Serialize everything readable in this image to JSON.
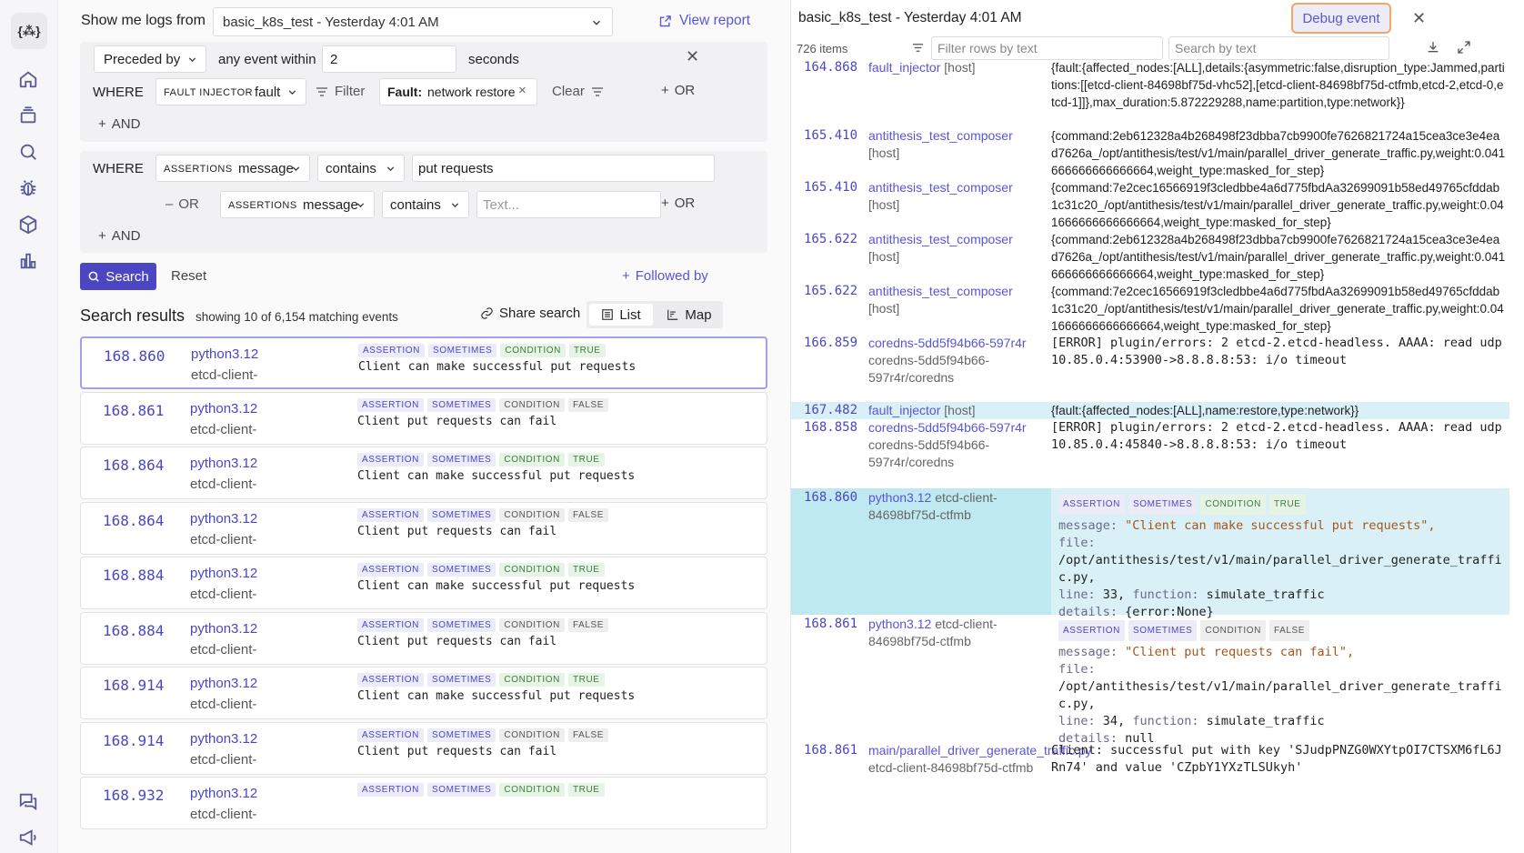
{
  "rail": {
    "logo": "{⁂}",
    "icons": [
      "home-icon",
      "layers-icon",
      "search-icon",
      "bug-icon",
      "cube-icon",
      "chart-icon",
      "chat-icon",
      "megaphone-icon"
    ]
  },
  "header": {
    "show_logs_label": "Show me logs from",
    "run_selected": "basic_k8s_test - Yesterday 4:01 AM",
    "view_report": "View report"
  },
  "preceded": {
    "mode": "Preceded by",
    "any_event_within": "any event within",
    "value": "2",
    "unit": "seconds",
    "where": "WHERE",
    "source_prefix": "FAULT INJECTOR",
    "source_field": "fault",
    "filter_label": "Filter",
    "chip_key": "Fault:",
    "chip_value": "network restore",
    "clear_label": "Clear",
    "or_label": "OR",
    "and_label": "AND"
  },
  "condition": {
    "where": "WHERE",
    "field_prefix": "ASSERTIONS",
    "field": "message",
    "op": "contains",
    "value": "put requests",
    "or_dash": "OR",
    "field2_prefix": "ASSERTIONS",
    "field2": "message",
    "op2": "contains",
    "placeholder2": "Text...",
    "or_label": "OR",
    "and_label": "AND"
  },
  "actions": {
    "search": "Search",
    "reset": "Reset",
    "followed_by": "Followed by"
  },
  "results": {
    "title": "Search results",
    "summary": "showing 10 of 6,154 matching events",
    "share": "Share search",
    "list": "List",
    "map": "Map",
    "items": [
      {
        "time": "168.860",
        "proc": "python3.12",
        "pod": "etcd-client-",
        "a": "ASSERTION",
        "s": "SOMETIMES",
        "c": "CONDITION",
        "v": "TRUE",
        "msg": "Client can make successful put requests"
      },
      {
        "time": "168.861",
        "proc": "python3.12",
        "pod": "etcd-client-",
        "a": "ASSERTION",
        "s": "SOMETIMES",
        "c": "CONDITION",
        "v": "FALSE",
        "msg": "Client put requests can fail"
      },
      {
        "time": "168.864",
        "proc": "python3.12",
        "pod": "etcd-client-",
        "a": "ASSERTION",
        "s": "SOMETIMES",
        "c": "CONDITION",
        "v": "TRUE",
        "msg": "Client can make successful put requests"
      },
      {
        "time": "168.864",
        "proc": "python3.12",
        "pod": "etcd-client-",
        "a": "ASSERTION",
        "s": "SOMETIMES",
        "c": "CONDITION",
        "v": "FALSE",
        "msg": "Client put requests can fail"
      },
      {
        "time": "168.884",
        "proc": "python3.12",
        "pod": "etcd-client-",
        "a": "ASSERTION",
        "s": "SOMETIMES",
        "c": "CONDITION",
        "v": "TRUE",
        "msg": "Client can make successful put requests"
      },
      {
        "time": "168.884",
        "proc": "python3.12",
        "pod": "etcd-client-",
        "a": "ASSERTION",
        "s": "SOMETIMES",
        "c": "CONDITION",
        "v": "FALSE",
        "msg": "Client put requests can fail"
      },
      {
        "time": "168.914",
        "proc": "python3.12",
        "pod": "etcd-client-",
        "a": "ASSERTION",
        "s": "SOMETIMES",
        "c": "CONDITION",
        "v": "TRUE",
        "msg": "Client can make successful put requests"
      },
      {
        "time": "168.914",
        "proc": "python3.12",
        "pod": "etcd-client-",
        "a": "ASSERTION",
        "s": "SOMETIMES",
        "c": "CONDITION",
        "v": "FALSE",
        "msg": "Client put requests can fail"
      },
      {
        "time": "168.932",
        "proc": "python3.12",
        "pod": "etcd-client-",
        "a": "ASSERTION",
        "s": "SOMETIMES",
        "c": "CONDITION",
        "v": "TRUE",
        "msg": ""
      }
    ]
  },
  "log": {
    "title": "basic_k8s_test - Yesterday 4:01 AM",
    "debug_event": "Debug event",
    "count": "726 items",
    "filter_placeholder": "Filter rows by text",
    "search_placeholder": "Search by text",
    "rows": [
      {
        "t": "164.868",
        "src": "fault_injector",
        "host": "[host]",
        "body": "{fault:{affected_nodes:[ALL],details:{asymmetric:false,disruption_type:Jammed,partitions:[[etcd-client-84698bf75d-vhc52],[etcd-client-84698bf75d-ctfmb,etcd-2,etcd-0,etcd-1]]},max_duration:5.872229288,name:partition,type:network}}"
      },
      {
        "t": "165.410",
        "src": "antithesis_test_composer",
        "host": "[host]",
        "body": "{command:2eb612328a4b268498f23dbba7cb9900fe7626821724a15cea3ce3e4ead7626a_/opt/antithesis/test/v1/main/parallel_driver_generate_traffic.py,weight:0.041666666666666664,weight_type:masked_for_step}"
      },
      {
        "t": "165.410",
        "src": "antithesis_test_composer",
        "host": "[host]",
        "body": "{command:7e2cec16566919f3cledbbe4a6d775fbdAa32699091b58ed49765cfddab1c31c20_/opt/antithesis/test/v1/main/parallel_driver_generate_traffic.py,weight:0.041666666666666664,weight_type:masked_for_step}"
      },
      {
        "t": "165.622",
        "src": "antithesis_test_composer",
        "host": "[host]",
        "body": "{command:2eb612328a4b268498f23dbba7cb9900fe7626821724a15cea3ce3e4ead7626a_/opt/antithesis/test/v1/main/parallel_driver_generate_traffic.py,weight:0.041666666666666664,weight_type:masked_for_step}"
      },
      {
        "t": "165.622",
        "src": "antithesis_test_composer",
        "host": "[host]",
        "body": "{command:7e2cec16566919f3cledbbe4a6d775fbdAa32699091b58ed49765cfddab1c31c20_/opt/antithesis/test/v1/main/parallel_driver_generate_traffic.py,weight:0.041666666666666664,weight_type:masked_for_step}"
      },
      {
        "t": "166.859",
        "src": "coredns-5dd5f94b66-597r4r",
        "host": "coredns-5dd5f94b66-597r4r/coredns",
        "body": "[ERROR] plugin/errors: 2 etcd-2.etcd-headless. AAAA: read udp 10.85.0.4:53900->8.8.8.8:53: i/o timeout"
      },
      {
        "t": "167.482",
        "src": "fault_injector",
        "host": "[host]",
        "body": "{fault:{affected_nodes:[ALL],name:restore,type:network}}"
      },
      {
        "t": "168.858",
        "src": "coredns-5dd5f94b66-597r4r",
        "host": "coredns-5dd5f94b66-597r4r/coredns",
        "body": "[ERROR] plugin/errors: 2 etcd-2.etcd-headless. AAAA: read udp 10.85.0.4:45840->8.8.8.8:53: i/o timeout"
      }
    ],
    "assert1": {
      "t": "168.860",
      "src": "python3.12",
      "host": "etcd-client-84698bf75d-ctfmb",
      "a": "ASSERTION",
      "s": "SOMETIMES",
      "c": "CONDITION",
      "v": "TRUE",
      "k_message": "message:",
      "message": "\"Client can make successful put requests\",",
      "k_file": "file:",
      "file": "/opt/antithesis/test/v1/main/parallel_driver_generate_traffic.py,",
      "k_line": "line:",
      "line": "33,",
      "k_function": "function:",
      "function": "simulate_traffic",
      "k_details": "details:",
      "details": "{error:None}"
    },
    "assert2": {
      "t": "168.861",
      "src": "python3.12",
      "host": "etcd-client-84698bf75d-ctfmb",
      "a": "ASSERTION",
      "s": "SOMETIMES",
      "c": "CONDITION",
      "v": "FALSE",
      "k_message": "message:",
      "message": "\"Client put requests can fail\",",
      "k_file": "file:",
      "file": "/opt/antithesis/test/v1/main/parallel_driver_generate_traffic.py,",
      "k_line": "line:",
      "line": "34,",
      "k_function": "function:",
      "function": "simulate_traffic",
      "k_details": "details:",
      "details": "null"
    },
    "last": {
      "t": "168.861",
      "src": "main/parallel_driver_generate_traffic.py",
      "host": "etcd-client-84698bf75d-ctfmb",
      "body": "Client: successful put with key 'SJudpPNZG0WXYtpOI7CTSXM6fL6JRn74' and value 'CZpbY1YXzTLSUkyh'"
    }
  }
}
